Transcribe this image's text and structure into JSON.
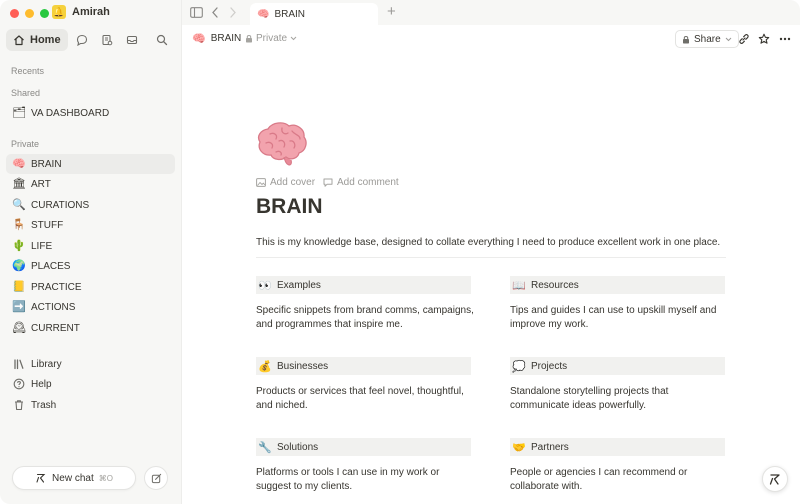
{
  "workspace": {
    "name": "Amirah",
    "icon": "workspace-bell-icon"
  },
  "nav": {
    "home_label": "Home"
  },
  "sidebar": {
    "recents_label": "Recents",
    "shared_label": "Shared",
    "private_label": "Private",
    "shared_items": [
      {
        "label": "VA DASHBOARD",
        "emoji": "🗂"
      }
    ],
    "private_items": [
      {
        "label": "BRAIN",
        "emoji": "🧠"
      },
      {
        "label": "ART",
        "emoji": "🏛"
      },
      {
        "label": "CURATIONS",
        "emoji": "🔍"
      },
      {
        "label": "STUFF",
        "emoji": "🪑"
      },
      {
        "label": "LIFE",
        "emoji": "🌵"
      },
      {
        "label": "PLACES",
        "emoji": "🌍"
      },
      {
        "label": "PRACTICE",
        "emoji": "📒"
      },
      {
        "label": "ACTIONS",
        "emoji": "➡️"
      },
      {
        "label": "CURRENT",
        "emoji": "🕰"
      }
    ],
    "bottom_items": [
      {
        "label": "Library",
        "icon": "library-icon"
      },
      {
        "label": "Help",
        "icon": "help-icon"
      },
      {
        "label": "Trash",
        "icon": "trash-icon"
      }
    ],
    "new_chat_label": "New chat",
    "new_chat_shortcut": "⌘O"
  },
  "tab": {
    "label": "BRAIN",
    "emoji": "🧠"
  },
  "breadcrumb": {
    "label": "BRAIN",
    "emoji": "🧠",
    "privacy": "Private"
  },
  "toolbar": {
    "share_label": "Share"
  },
  "page": {
    "add_cover": "Add cover",
    "add_comment": "Add comment",
    "title": "BRAIN",
    "description": "This is my knowledge base, designed to collate everything I need to produce excellent work in one place.",
    "sections": [
      {
        "heading": "Examples",
        "emoji": "👀",
        "text": "Specific snippets from brand comms, campaigns, and programmes that inspire me."
      },
      {
        "heading": "Resources",
        "emoji": "📖",
        "text": "Tips and guides I can use to upskill myself and improve my work."
      },
      {
        "heading": "Businesses",
        "emoji": "💰",
        "text": "Products or services that feel novel, thoughtful, and niched."
      },
      {
        "heading": "Projects",
        "emoji": "💭",
        "text": "Standalone storytelling projects that communicate ideas powerfully."
      },
      {
        "heading": "Solutions",
        "emoji": "🔧",
        "text": "Platforms or tools I can use in my work or suggest to my clients."
      },
      {
        "heading": "Partners",
        "emoji": "🤝",
        "text": "People or agencies I can recommend or collaborate with."
      }
    ]
  },
  "colors": {
    "sidebar_bg": "#f7f7f5",
    "card_header_bg": "#f1f1ef",
    "text": "#37352f",
    "muted": "#9b9a97"
  }
}
